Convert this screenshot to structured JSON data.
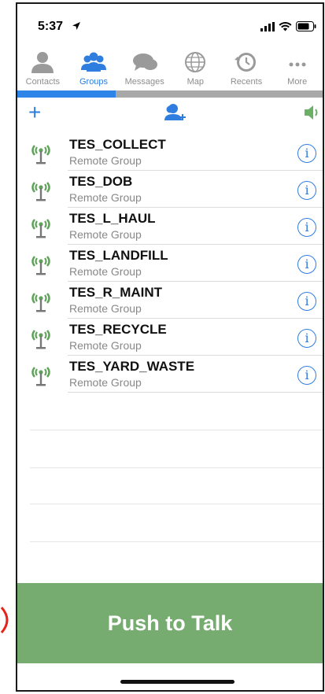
{
  "status": {
    "time": "5:37"
  },
  "tabs": [
    {
      "label": "Contacts",
      "icon": "person-icon",
      "active": false
    },
    {
      "label": "Groups",
      "icon": "groups-icon",
      "active": true
    },
    {
      "label": "Messages",
      "icon": "messages-icon",
      "active": false
    },
    {
      "label": "Map",
      "icon": "globe-icon",
      "active": false
    },
    {
      "label": "Recents",
      "icon": "recents-icon",
      "active": false
    },
    {
      "label": "More",
      "icon": "more-icon",
      "active": false
    }
  ],
  "toolbar": {
    "add_label": "+"
  },
  "groups": [
    {
      "name": "TES_COLLECT",
      "subtitle": "Remote Group"
    },
    {
      "name": "TES_DOB",
      "subtitle": "Remote Group"
    },
    {
      "name": "TES_L_HAUL",
      "subtitle": "Remote Group"
    },
    {
      "name": "TES_LANDFILL",
      "subtitle": "Remote Group"
    },
    {
      "name": "TES_R_MAINT",
      "subtitle": "Remote Group"
    },
    {
      "name": "TES_RECYCLE",
      "subtitle": "Remote Group"
    },
    {
      "name": "TES_YARD_WASTE",
      "subtitle": "Remote Group"
    }
  ],
  "info_glyph": "i",
  "ptt": {
    "label": "Push to Talk"
  },
  "colors": {
    "accent": "#2f7ddf",
    "ptt_green": "#76ac6f",
    "antenna_green": "#5fa35a"
  }
}
